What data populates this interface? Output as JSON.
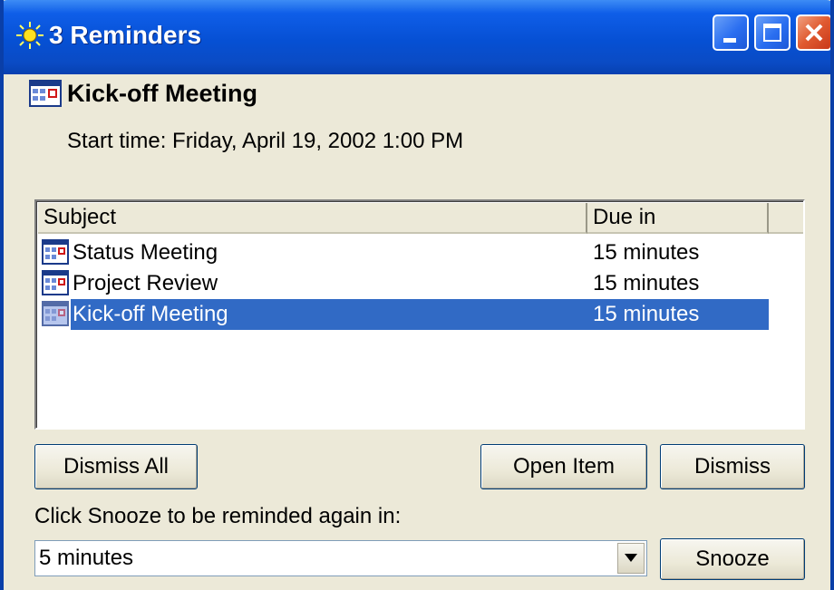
{
  "window": {
    "title": "3 Reminders",
    "controls": [
      "minimize",
      "maximize",
      "close"
    ]
  },
  "header": {
    "title": "Kick-off Meeting",
    "start_time": "Start time: Friday, April 19, 2002 1:00 PM"
  },
  "list": {
    "columns": [
      "Subject",
      "Due in"
    ],
    "rows": [
      {
        "subject": "Status Meeting",
        "due": "15 minutes",
        "selected": false
      },
      {
        "subject": "Project Review",
        "due": "15 minutes",
        "selected": false
      },
      {
        "subject": "Kick-off Meeting",
        "due": "15 minutes",
        "selected": true
      }
    ]
  },
  "buttons": {
    "dismiss_all": "Dismiss All",
    "open_item": "Open Item",
    "dismiss": "Dismiss",
    "snooze": "Snooze"
  },
  "snooze": {
    "label": "Click Snooze to be reminded again in:",
    "selected": "5 minutes"
  },
  "colors": {
    "titlebar": "#0650d4",
    "selection": "#316ac5",
    "dialog_bg": "#ece9d8"
  },
  "icons": {
    "title": "bell-alarm-icon",
    "appointment": "calendar-appointment-icon"
  }
}
